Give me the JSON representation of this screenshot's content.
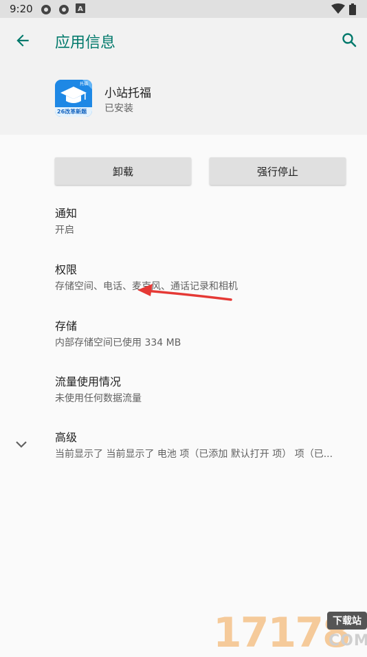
{
  "status_bar": {
    "time": "9:20",
    "icons": [
      "gear-icon",
      "gear-icon",
      "a-icon",
      "wifi-icon",
      "battery-icon"
    ]
  },
  "header": {
    "title": "应用信息",
    "back_icon": "arrow-back-icon",
    "search_icon": "search-icon",
    "accent_color": "#00796b"
  },
  "app": {
    "name": "小站托福",
    "status": "已安装",
    "icon_badge": "26改革新题",
    "icon_tag": "托福",
    "icon_color": "#1e88e5"
  },
  "buttons": {
    "uninstall": "卸载",
    "force_stop": "强行停止"
  },
  "settings": [
    {
      "title": "通知",
      "subtitle": "开启"
    },
    {
      "title": "权限",
      "subtitle": "存储空间、电话、麦克风、通话记录和相机"
    },
    {
      "title": "存储",
      "subtitle": "内部存储空间已使用 334 MB"
    },
    {
      "title": "流量使用情况",
      "subtitle": "未使用任何数据流量"
    },
    {
      "title": "高级",
      "subtitle": "当前显示了 当前显示了 电池 项（已添加 默认打开 项） 项（已..."
    }
  ],
  "watermark": {
    "number": "17178",
    "badge": "下载站",
    "suffix": "COM"
  },
  "annotation_color": "#e53935"
}
